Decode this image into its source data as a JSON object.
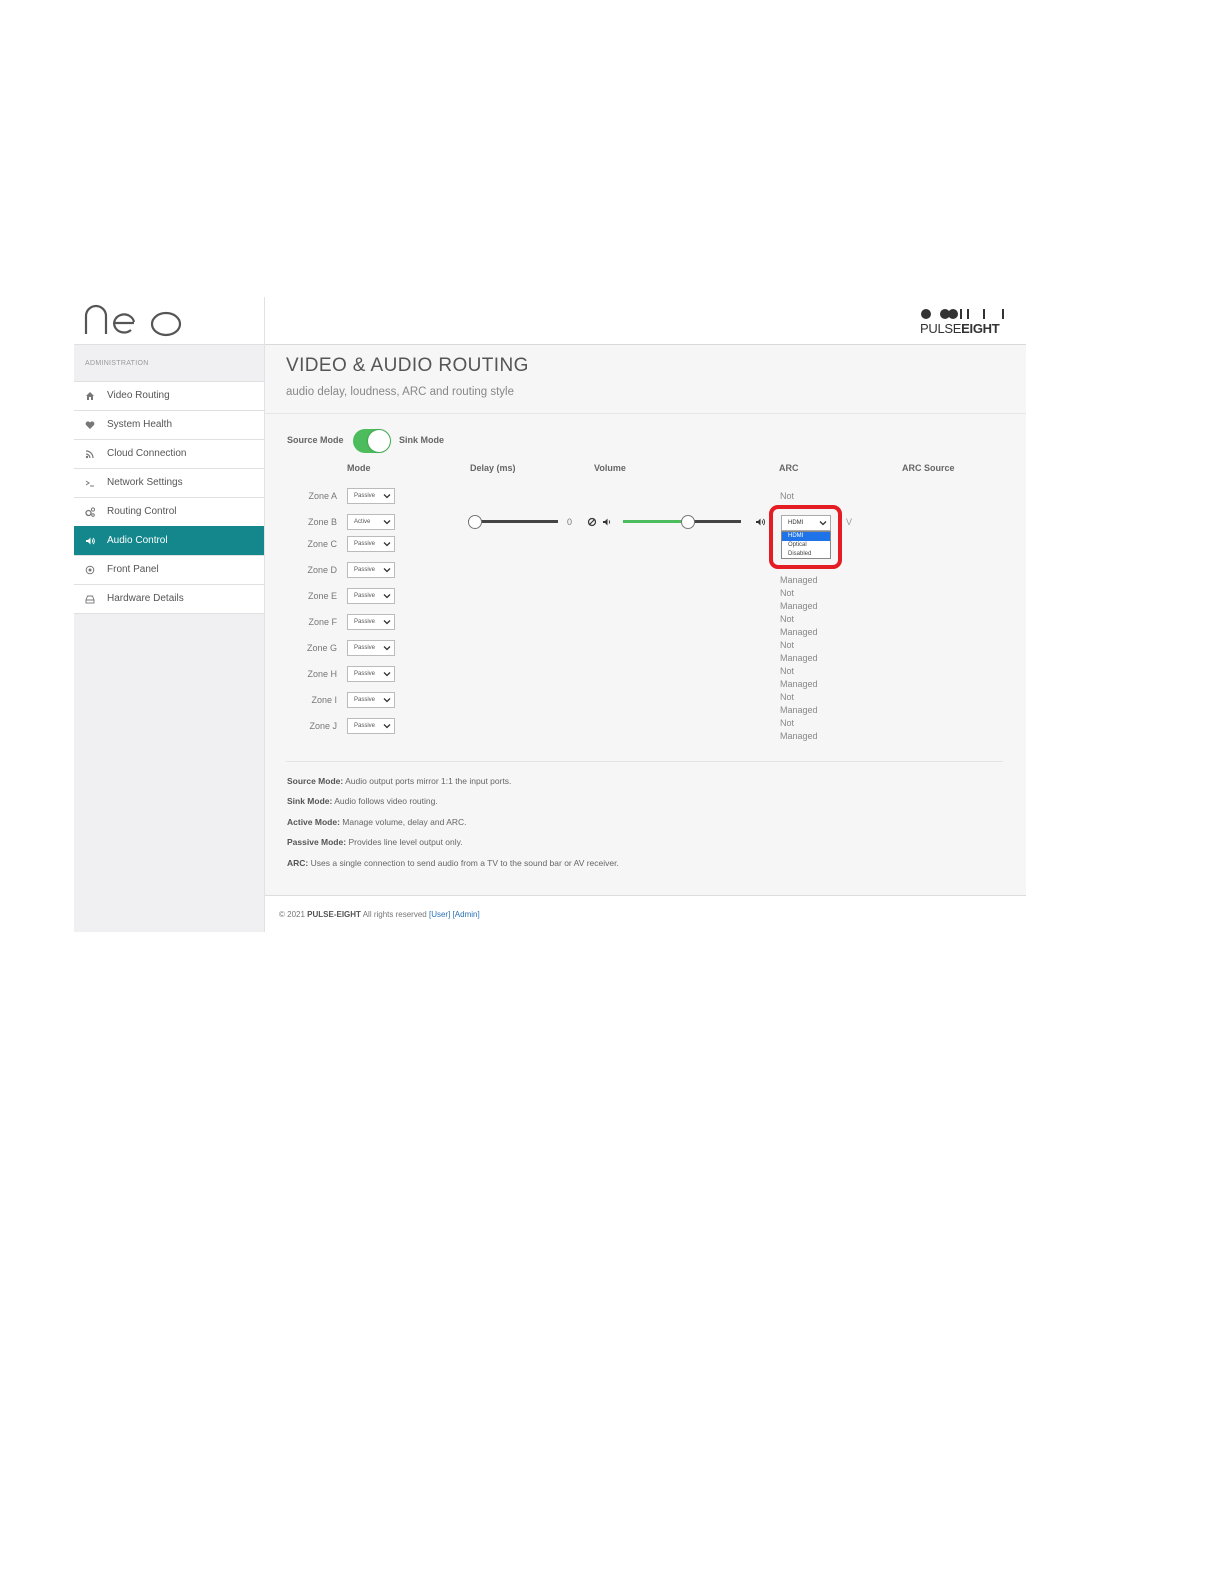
{
  "app": {
    "logo_text": "neo",
    "brand_logo_left": "PULSE",
    "brand_logo_right": "EIGHT"
  },
  "sidebar": {
    "section_label": "ADMINISTRATION",
    "items": [
      {
        "label": "Video Routing",
        "icon": "home-icon"
      },
      {
        "label": "System Health",
        "icon": "heart-icon"
      },
      {
        "label": "Cloud Connection",
        "icon": "rss-icon"
      },
      {
        "label": "Network Settings",
        "icon": "terminal-icon"
      },
      {
        "label": "Routing Control",
        "icon": "cogs-icon"
      },
      {
        "label": "Audio Control",
        "icon": "speaker-icon",
        "active": true
      },
      {
        "label": "Front Panel",
        "icon": "target-icon"
      },
      {
        "label": "Hardware Details",
        "icon": "hdd-icon"
      }
    ],
    "active_color": "#14878c"
  },
  "page": {
    "title": "VIDEO & AUDIO ROUTING",
    "subtitle": "audio delay, loudness, ARC and routing style"
  },
  "mode_toggle": {
    "left_label": "Source Mode",
    "right_label": "Sink Mode",
    "state": "Sink Mode",
    "color": "#4cbc5c"
  },
  "table": {
    "headers": {
      "mode": "Mode",
      "delay": "Delay (ms)",
      "volume": "Volume",
      "arc": "ARC",
      "arc_source": "ARC Source"
    },
    "zones": [
      {
        "name": "Zone A",
        "mode": "Passive"
      },
      {
        "name": "Zone B",
        "mode": "Active"
      },
      {
        "name": "Zone C",
        "mode": "Passive"
      },
      {
        "name": "Zone D",
        "mode": "Passive"
      },
      {
        "name": "Zone E",
        "mode": "Passive"
      },
      {
        "name": "Zone F",
        "mode": "Passive"
      },
      {
        "name": "Zone G",
        "mode": "Passive"
      },
      {
        "name": "Zone H",
        "mode": "Passive"
      },
      {
        "name": "Zone I",
        "mode": "Passive"
      },
      {
        "name": "Zone J",
        "mode": "Passive"
      }
    ],
    "arc_not": "Not",
    "arc_managed": "Managed",
    "zone_b": {
      "delay_value": "0",
      "delay_fraction": 0.0,
      "volume_fraction": 0.55,
      "arc_selected": "HDMI",
      "arc_options": [
        "HDMI",
        "Optical",
        "Disabled"
      ],
      "arc_source_partial": "V"
    }
  },
  "legend": [
    {
      "term": "Source Mode:",
      "desc": "Audio output ports mirror 1:1 the input ports."
    },
    {
      "term": "Sink Mode:",
      "desc": "Audio follows video routing."
    },
    {
      "term": "Active Mode:",
      "desc": "Manage volume, delay and ARC."
    },
    {
      "term": "Passive Mode:",
      "desc": "Provides line level output only."
    },
    {
      "term": "ARC:",
      "desc": "Uses a single connection to send audio from a TV to the sound bar or AV receiver."
    }
  ],
  "footer": {
    "copyright": "© 2021",
    "brand": "PULSE-EIGHT",
    "rights": "All rights reserved",
    "user_link": "[User]",
    "admin_link": "[Admin]"
  },
  "highlight_color": "#e41c24"
}
